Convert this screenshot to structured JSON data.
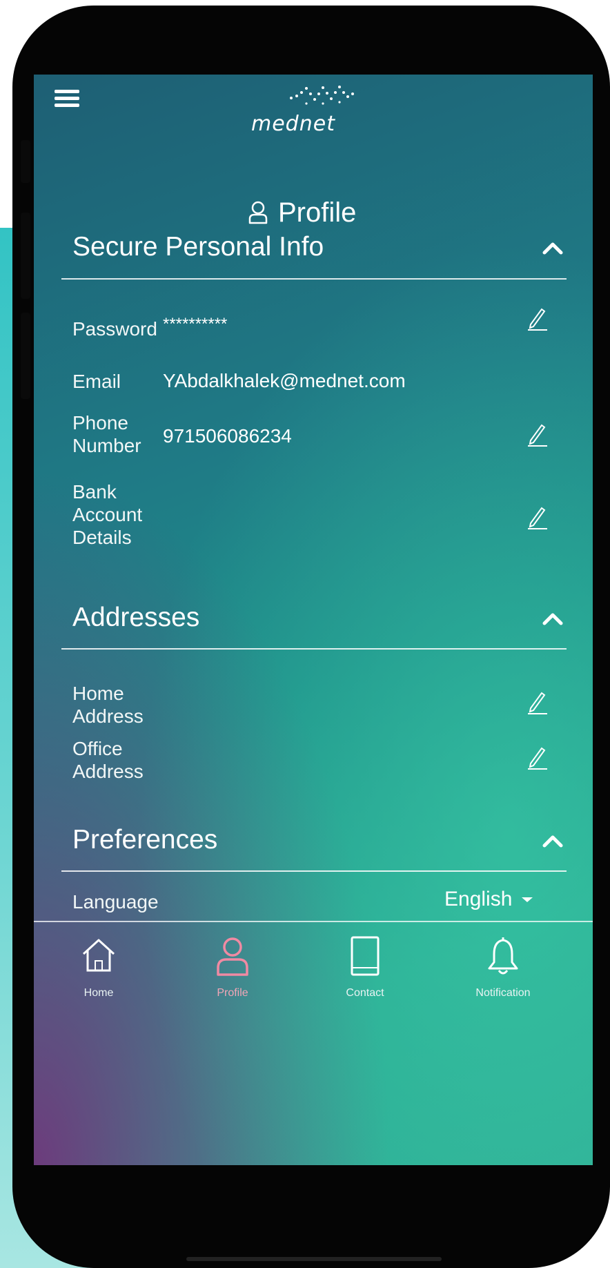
{
  "app": {
    "logo_text": "mednet",
    "page_title": "Profile"
  },
  "sections": {
    "secure": {
      "title": "Secure Personal Info",
      "password_label": "Password",
      "password_value": "**********",
      "email_label": "Email",
      "email_value": "YAbdalkhalek@mednet.com",
      "phone_label_line1": "Phone",
      "phone_label_line2": "Number",
      "phone_value": "971506086234",
      "bank_label_line1": "Bank",
      "bank_label_line2": "Account",
      "bank_label_line3": "Details"
    },
    "addresses": {
      "title": "Addresses",
      "home_label_line1": "Home",
      "home_label_line2": "Address",
      "office_label_line1": "Office",
      "office_label_line2": "Address"
    },
    "preferences": {
      "title": "Preferences",
      "language_label": "Language",
      "language_value": "English"
    }
  },
  "tabs": [
    {
      "label": "Home",
      "icon": "home-icon"
    },
    {
      "label": "Profile",
      "icon": "user-icon"
    },
    {
      "label": "Contact",
      "icon": "book-icon"
    },
    {
      "label": "Notification",
      "icon": "bell-icon"
    }
  ],
  "colors": {
    "accent_active_tab": "#f08aa3",
    "screen_teal": "#1e8f8a",
    "screen_purple": "#782878"
  }
}
